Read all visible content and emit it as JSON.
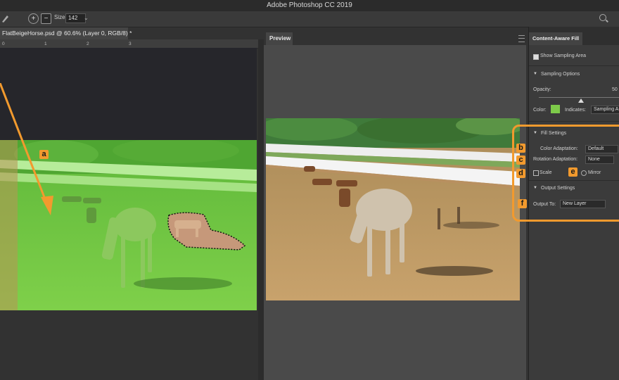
{
  "app": {
    "title": "Adobe Photoshop CC 2019"
  },
  "options_bar": {
    "size_label": "Size:",
    "size_value": "142"
  },
  "document": {
    "tab_title": "FlatBeigeHorse.psd @ 60.6% (Layer 0, RGB/8) *",
    "ruler_ticks": [
      "0",
      "1",
      "2",
      "3"
    ]
  },
  "preview": {
    "tab_label": "Preview"
  },
  "panel": {
    "tab_label": "Content-Aware Fill",
    "show_sampling_area": "Show Sampling Area",
    "sampling_options": {
      "header": "Sampling Options",
      "opacity_label": "Opacity:",
      "opacity_value": "50",
      "opacity_fraction": 0.5,
      "color_label": "Color:",
      "color_swatch": "#7ecb4a",
      "indicates_label": "Indicates:",
      "indicates_value": "Sampling A"
    },
    "fill_settings": {
      "header": "Fill Settings",
      "color_adaptation_label": "Color Adaptation:",
      "color_adaptation_value": "Default",
      "rotation_adaptation_label": "Rotation Adaptation:",
      "rotation_adaptation_value": "None",
      "scale_label": "Scale",
      "mirror_label": "Mirror"
    },
    "output_settings": {
      "header": "Output Settings",
      "output_to_label": "Output To:",
      "output_to_value": "New Layer"
    }
  },
  "annotations": {
    "a": "a",
    "b": "b",
    "c": "c",
    "d": "d",
    "e": "e",
    "f": "f"
  },
  "colors": {
    "accent": "#f29a2e",
    "overlay_green": "#7ed448",
    "panel_bg": "#3b3b3b"
  }
}
